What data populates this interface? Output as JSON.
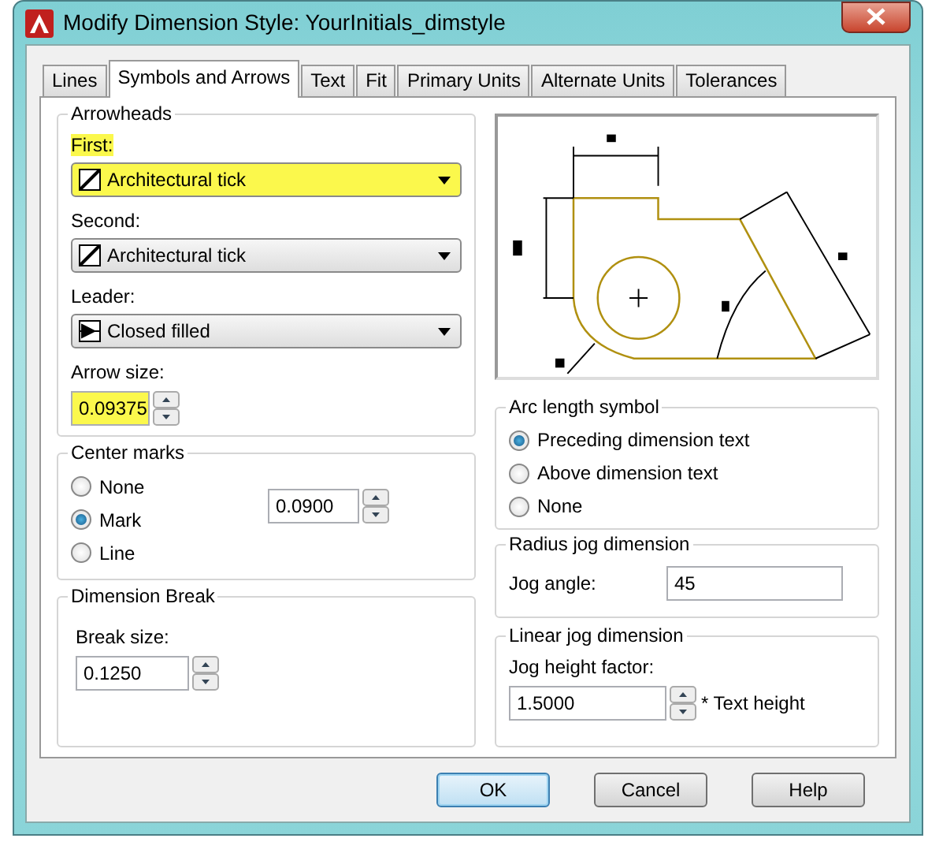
{
  "window": {
    "title": "Modify Dimension Style: YourInitials_dimstyle"
  },
  "tabs": [
    {
      "label": "Lines",
      "selected": false
    },
    {
      "label": "Symbols and Arrows",
      "selected": true
    },
    {
      "label": "Text",
      "selected": false
    },
    {
      "label": "Fit",
      "selected": false
    },
    {
      "label": "Primary Units",
      "selected": false
    },
    {
      "label": "Alternate Units",
      "selected": false
    },
    {
      "label": "Tolerances",
      "selected": false
    }
  ],
  "arrowheads": {
    "title": "Arrowheads",
    "fields": [
      {
        "label": "First:",
        "value": "Architectural tick",
        "kind": "tick",
        "highlighted": true
      },
      {
        "label": "Second:",
        "value": "Architectural tick",
        "kind": "tick",
        "highlighted": false
      },
      {
        "label": "Leader:",
        "value": "Closed filled",
        "kind": "filled",
        "highlighted": false
      }
    ],
    "arrow_size": {
      "label": "Arrow size:",
      "value": "0.09375",
      "highlighted": true
    }
  },
  "center_marks": {
    "title": "Center marks",
    "options": [
      {
        "label": "None",
        "selected": false
      },
      {
        "label": "Mark",
        "selected": true
      },
      {
        "label": "Line",
        "selected": false
      }
    ],
    "size": "0.0900"
  },
  "dimension_break": {
    "title": "Dimension Break",
    "label": "Break size:",
    "value": "0.1250"
  },
  "arc_length_symbol": {
    "title": "Arc length symbol",
    "options": [
      {
        "label": "Preceding dimension text",
        "selected": true
      },
      {
        "label": "Above dimension text",
        "selected": false
      },
      {
        "label": "None",
        "selected": false
      }
    ]
  },
  "radius_jog": {
    "title": "Radius jog dimension",
    "label": "Jog angle:",
    "value": "45"
  },
  "linear_jog": {
    "title": "Linear jog dimension",
    "label": "Jog height factor:",
    "value": "1.5000",
    "suffix": "* Text height"
  },
  "buttons": [
    {
      "label": "OK",
      "default": true
    },
    {
      "label": "Cancel",
      "default": false
    },
    {
      "label": "Help",
      "default": false
    }
  ]
}
